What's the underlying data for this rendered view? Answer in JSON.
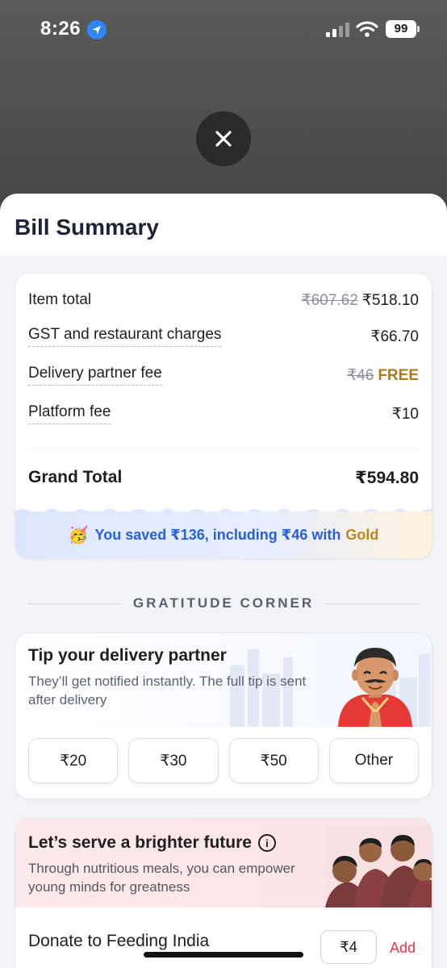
{
  "status_bar": {
    "time": "8:26",
    "battery": "99"
  },
  "sheet": {
    "title": "Bill Summary"
  },
  "bill": {
    "item_total_label": "Item total",
    "item_total_original": "₹607.62",
    "item_total_value": "₹518.10",
    "gst_label": "GST and restaurant charges",
    "gst_value": "₹66.70",
    "delivery_label": "Delivery partner fee",
    "delivery_original": "₹46",
    "delivery_value": "FREE",
    "platform_label": "Platform fee",
    "platform_value": "₹10",
    "grand_total_label": "Grand Total",
    "grand_total_value": "₹594.80",
    "savings_text": "You saved ₹136, including ₹46 with",
    "savings_gold": "Gold"
  },
  "gratitude": {
    "section_title": "GRATITUDE CORNER"
  },
  "tip": {
    "title": "Tip your delivery partner",
    "subtitle": "They’ll get notified instantly. The full tip is sent after delivery",
    "options": [
      "₹20",
      "₹30",
      "₹50",
      "Other"
    ]
  },
  "donate": {
    "title": "Let’s serve a brighter future",
    "subtitle": "Through nutritious meals, you can empower young minds for greatness",
    "label": "Donate to Feeding India",
    "amount": "₹4",
    "add_label": "Add"
  },
  "colors": {
    "accent_red": "#e23744",
    "savings_blue": "#2b5fd9",
    "gold": "#b88a1e"
  }
}
